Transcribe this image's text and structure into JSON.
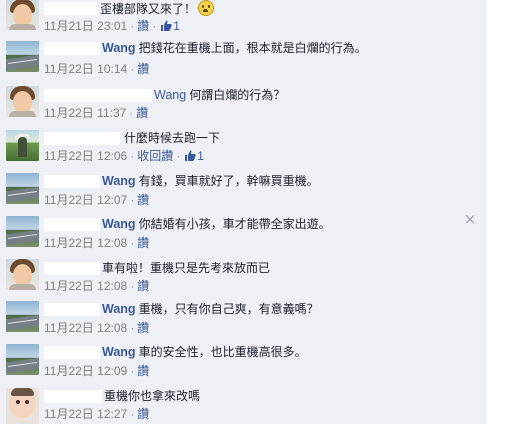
{
  "panel": {
    "close_icon": "close-icon",
    "close_glyph": "×"
  },
  "comments": [
    {
      "avatar": "person",
      "author": "",
      "text": "歪樓部隊又來了！",
      "emoji": "worried-face-emoji",
      "date": "11月21日",
      "time": "23:01",
      "action": "讚",
      "likes": "1"
    },
    {
      "avatar": "road",
      "author": "Wang",
      "text": "把錢花在重機上面，根本就是白爛的行為。",
      "date": "11月22日",
      "time": "10:14",
      "action": "讚"
    },
    {
      "avatar": "person",
      "author": "Wang",
      "text": "何謂白爛的行為？",
      "date": "11月22日",
      "time": "11:37",
      "action": "讚"
    },
    {
      "avatar": "garden",
      "author": "",
      "text": "什麼時候去跑一下",
      "date": "11月22日",
      "time": "12:06",
      "action": "收回讚",
      "likes": "1"
    },
    {
      "avatar": "road",
      "author": "Wang",
      "text": "有錢，買車就好了，幹嘛買重機。",
      "date": "11月22日",
      "time": "12:07",
      "action": "讚"
    },
    {
      "avatar": "road",
      "author": "Wang",
      "text": "你結婚有小孩，車才能帶全家出遊。",
      "date": "11月22日",
      "time": "12:08",
      "action": "讚"
    },
    {
      "avatar": "person",
      "author": "",
      "text": "車有啦！重機只是先考來放而已",
      "date": "11月22日",
      "time": "12:08",
      "action": "讚"
    },
    {
      "avatar": "road",
      "author": "Wang",
      "text": "重機，只有你自己爽，有意義嗎？",
      "date": "11月22日",
      "time": "12:08",
      "action": "讚"
    },
    {
      "avatar": "road",
      "author": "Wang",
      "text": "車的安全性，也比重機高很多。",
      "date": "11月22日",
      "time": "12:09",
      "action": "讚"
    },
    {
      "avatar": "baby",
      "author": "",
      "text": "重機你也拿來改嗎",
      "date": "11月22日",
      "time": "12:27",
      "action": "讚"
    }
  ],
  "icons": {
    "like": "thumbs-up-icon"
  },
  "colors": {
    "panel_bg": "#eef0f5",
    "link": "#3b5998",
    "meta": "#7f7f7f"
  }
}
